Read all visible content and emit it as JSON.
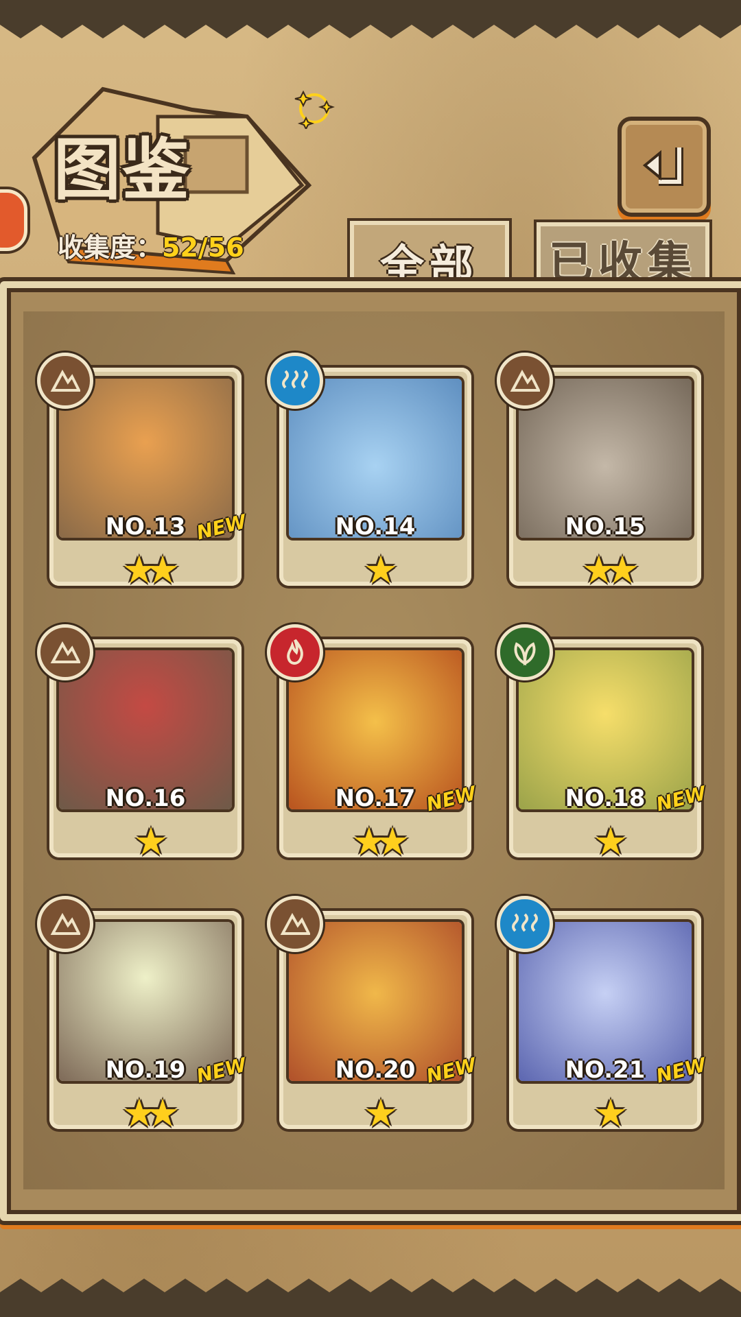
{
  "header": {
    "title": "图鉴",
    "collection_label": "收集度：",
    "collection_value": "52/56"
  },
  "tabs": [
    {
      "label": "全部",
      "active": true
    },
    {
      "label": "已收集",
      "active": false
    }
  ],
  "element_icons": {
    "earth": "earth-element-icon",
    "water": "water-element-icon",
    "fire": "fire-element-icon",
    "leaf": "leaf-element-icon"
  },
  "cards": [
    {
      "number": "NO.13",
      "element": "earth",
      "stars": "★★",
      "new": "NEW",
      "color": "#d9833a"
    },
    {
      "number": "NO.14",
      "element": "water",
      "stars": "★",
      "new": "",
      "color": "#8fbce6"
    },
    {
      "number": "NO.15",
      "element": "earth",
      "stars": "★★",
      "new": "",
      "color": "#a69a8a"
    },
    {
      "number": "NO.16",
      "element": "earth",
      "stars": "★",
      "new": "",
      "color": "#b33b3b"
    },
    {
      "number": "NO.17",
      "element": "fire",
      "stars": "★★",
      "new": "NEW",
      "color": "#f0a43a"
    },
    {
      "number": "NO.18",
      "element": "leaf",
      "stars": "★",
      "new": "NEW",
      "color": "#f2cd46"
    },
    {
      "number": "NO.19",
      "element": "earth",
      "stars": "★★",
      "new": "NEW",
      "color": "#8f7a66"
    },
    {
      "number": "NO.20",
      "element": "earth",
      "stars": "★",
      "new": "NEW",
      "color": "#e46a3a"
    },
    {
      "number": "NO.21",
      "element": "water",
      "stars": "★",
      "new": "NEW",
      "color": "#9aa9e8"
    }
  ]
}
